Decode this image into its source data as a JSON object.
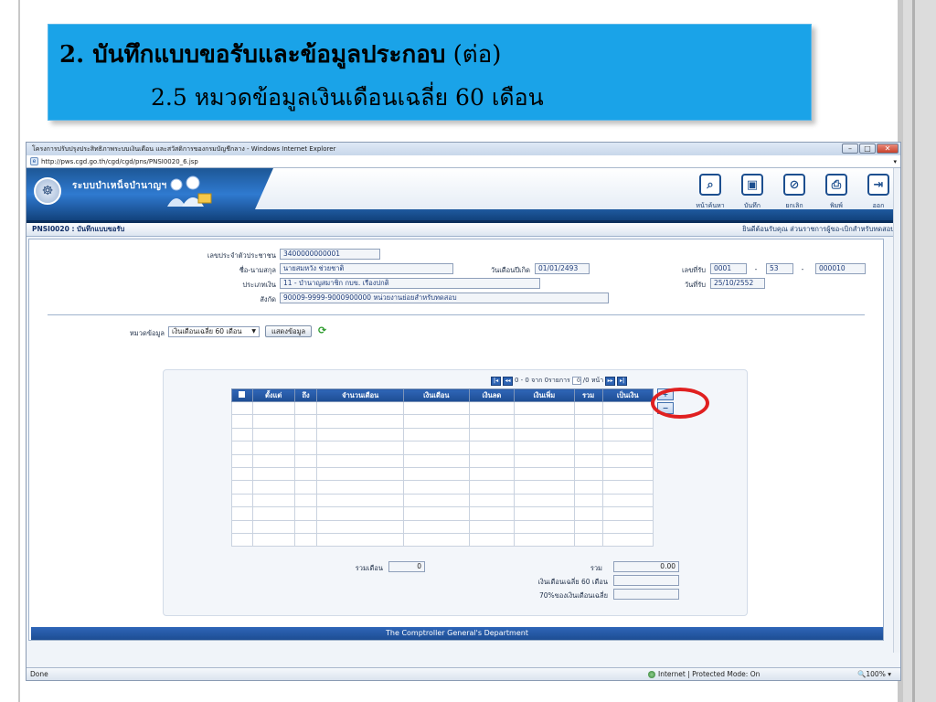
{
  "slide": {
    "title_line1_bold": "2. บันทึกแบบขอรับและข้อมูลประกอบ",
    "title_line1_rest": " (ต่อ)",
    "title_line2": "2.5 หมวดข้อมูลเงินเดือนเฉลี่ย 60 เดือน"
  },
  "browser": {
    "window_title": "โครงการปรับปรุงประสิทธิภาพระบบเงินเดือน และสวัสดิการของกรมบัญชีกลาง - Windows Internet Explorer",
    "address": "http://pws.cgd.go.th/cgd/cgd/pns/PNSI0020_6.jsp",
    "status_done": "Done",
    "zone": "Internet | Protected Mode: On",
    "zoom": "100%"
  },
  "app": {
    "name": "ระบบบำเหน็จบำนาญฯ",
    "toolbar": [
      "หน้าค้นหา",
      "บันทึก",
      "ยกเลิก",
      "พิมพ์",
      "ออก"
    ],
    "screen_id": "PNSI0020 : บันทึกแบบขอรับ",
    "welcome": "ยินดีต้อนรับคุณ ส่วนราชการผู้ขอ-เบิกสำหรับทดสอบ",
    "footer": "The Comptroller General's Department"
  },
  "form": {
    "citizen_id_label": "เลขประจำตัวประชาชน",
    "citizen_id": "3400000000001",
    "name_label": "ชื่อ-นามสกุล",
    "name": "นายสมหวัง ช่วยชาติ",
    "birth_label": "วันเดือนปีเกิด",
    "birth": "01/01/2493",
    "type_label": "ประเภทเงิน",
    "type": "11 - บำนาญสมาชิก กบข. เรืองปกติ",
    "org_label": "สังกัด",
    "org": "90009-9999-9000900000  หน่วยงานย่อยสำหรับทดสอบ",
    "receive_no_label": "เลขที่รับ",
    "receive_no_1": "0001",
    "receive_no_2": "53",
    "receive_no_3": "000010",
    "receive_date_label": "วันที่รับ",
    "receive_date": "25/10/2552",
    "category_label": "หมวดข้อมูล",
    "category": "เงินเดือนเฉลี่ย 60 เดือน",
    "show_button": "แสดงข้อมูล"
  },
  "grid": {
    "pager_text": "0 - 0 จาก 0รายการ",
    "page_value": "0",
    "page_total": "/0 หน้า",
    "columns": [
      "ตั้งแต่",
      "ถึง",
      "จำนวนเดือน",
      "เงินเดือน",
      "เงินลด",
      "เงินเพิ่ม",
      "รวม",
      "เป็นเงิน"
    ],
    "total_months_label": "รวมเดือน",
    "total_months": "0",
    "sum_label": "รวม",
    "sum": "0.00",
    "avg_label": "เงินเดือนเฉลี่ย 60 เดือน",
    "pct_label": "70%ของเงินเดือนเฉลี่ย"
  }
}
